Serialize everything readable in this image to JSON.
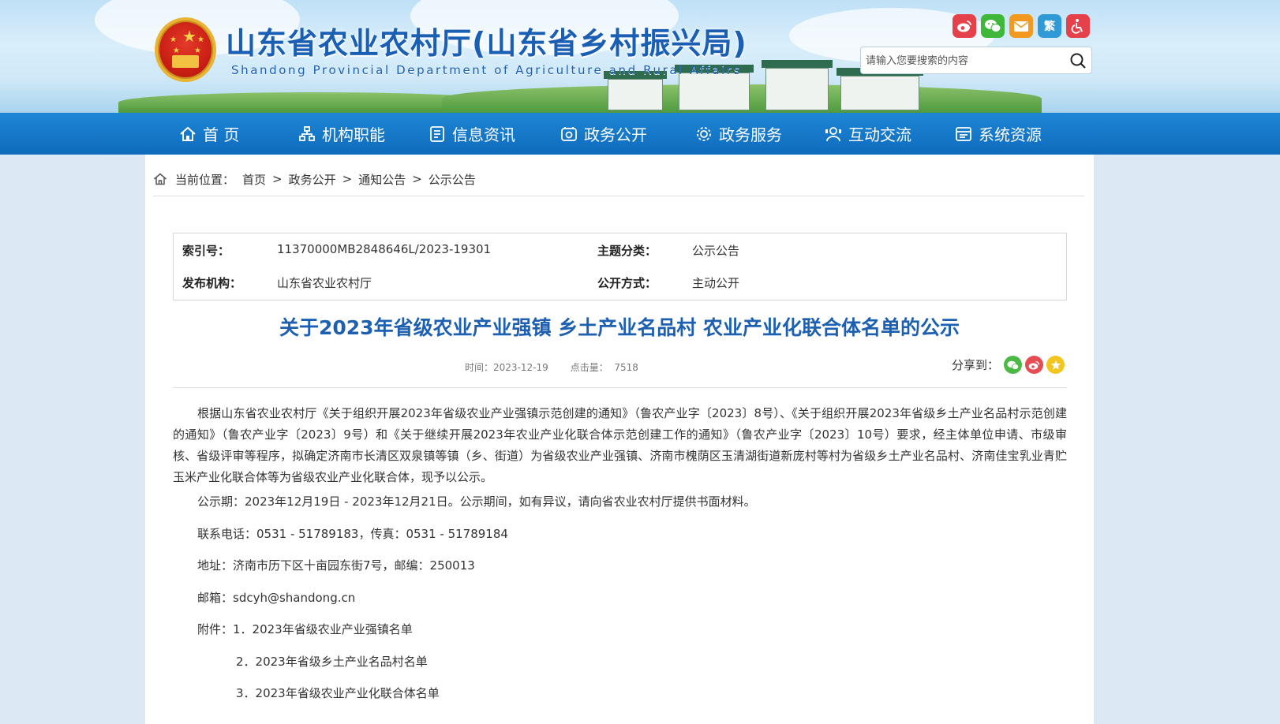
{
  "header": {
    "site_title": "山东省农业农村厅(山东省乡村振兴局)",
    "site_subtitle": "Shandong Provincial Department of Agriculture and Rural Affairs",
    "top_icons": [
      {
        "icon": "weibo-icon",
        "color": "#e5414b"
      },
      {
        "icon": "wechat-icon",
        "color": "#3fb73a"
      },
      {
        "icon": "mail-icon",
        "color": "#f19a1f"
      },
      {
        "icon": "traditional-chinese-icon",
        "label": "繁",
        "color": "#2f9ad6"
      },
      {
        "icon": "accessibility-icon",
        "color": "#e5414b"
      }
    ],
    "search_placeholder": "请输入您要搜索的内容"
  },
  "nav": {
    "items": [
      {
        "label": "首 页",
        "icon": "home-icon"
      },
      {
        "label": "机构职能",
        "icon": "org-icon"
      },
      {
        "label": "信息资讯",
        "icon": "news-icon"
      },
      {
        "label": "政务公开",
        "icon": "disclosure-icon"
      },
      {
        "label": "政务服务",
        "icon": "service-icon"
      },
      {
        "label": "互动交流",
        "icon": "interaction-icon"
      },
      {
        "label": "系统资源",
        "icon": "resource-icon"
      }
    ]
  },
  "breadcrumb": {
    "prefix": "当前位置：",
    "items": [
      "首页",
      "政务公开",
      "通知公告",
      "公示公告"
    ],
    "separator": ">"
  },
  "meta": {
    "index_label": "索引号：",
    "index_value": "11370000MB2848646L/2023-19301",
    "topic_label": "主题分类：",
    "topic_value": "公示公告",
    "publisher_label": "发布机构：",
    "publisher_value": "山东省农业农村厅",
    "mode_label": "公开方式：",
    "mode_value": "主动公开"
  },
  "article": {
    "title": "关于2023年省级农业产业强镇 乡土产业名品村 农业产业化联合体名单的公示",
    "time_label": "时间：2023-12-19",
    "views_label": "点击量：",
    "views_value": "7518",
    "share_label": "分享到：",
    "paragraph_1": "根据山东省农业农村厅《关于组织开展2023年省级农业产业强镇示范创建的通知》（鲁农产业字〔2023〕8号）、《关于组织开展2023年省级乡土产业名品村示范创建的通知》（鲁农产业字〔2023〕9号）和《关于继续开展2023年农业产业化联合体示范创建工作的通知》（鲁农产业字〔2023〕10号）要求，经主体单位申请、市级审核、省级评审等程序，拟确定济南市长清区双泉镇等镇（乡、街道）为省级农业产业强镇、济南市槐荫区玉清湖街道新庞村等村为省级乡土产业名品村、济南佳宝乳业青贮玉米产业化联合体等为省级农业产业化联合体，现予以公示。",
    "period": "公示期：2023年12月19日 - 2023年12月21日。公示期间，如有异议，请向省农业农村厅提供书面材料。",
    "phone": "联系电话：0531 - 51789183，传真：0531 - 51789184",
    "address": "地址：济南市历下区十亩园东街7号，邮编：250013",
    "email": "邮箱：sdcyh@shandong.cn",
    "attachment_1": "附件：1．2023年省级农业产业强镇名单",
    "attachment_2": "2．2023年省级乡土产业名品村名单",
    "attachment_3": "3．2023年省级农业产业化联合体名单"
  }
}
